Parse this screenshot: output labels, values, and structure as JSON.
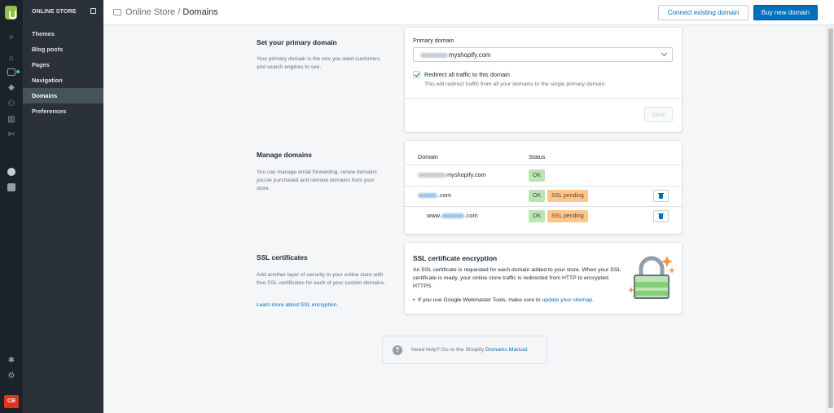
{
  "sidebar": {
    "section_title": "ONLINE STORE",
    "items": [
      {
        "label": "Themes"
      },
      {
        "label": "Blog posts"
      },
      {
        "label": "Pages"
      },
      {
        "label": "Navigation"
      },
      {
        "label": "Domains",
        "active": true
      },
      {
        "label": "Preferences"
      }
    ],
    "rail_icons": [
      "shopify-logo-icon",
      "search-icon",
      "home-icon",
      "orders-icon",
      "tag-icon",
      "customers-icon",
      "analytics-icon",
      "discounts-icon",
      "online-store-icon",
      "facebook-icon",
      "apps-icon",
      "settings-icon"
    ],
    "avatar_initials": "CB"
  },
  "header": {
    "breadcrumb_parent": "Online Store",
    "breadcrumb_sep": "/",
    "breadcrumb_current": "Domains",
    "connect_button": "Connect existing domain",
    "buy_button": "Buy new domain"
  },
  "primary": {
    "title": "Set your primary domain",
    "description": "Your primary domain is the one you want customers and search engines to see.",
    "field_label": "Primary domain",
    "selected_domain_suffix": "myshopify.com",
    "redirect_label": "Redirect all traffic to this domain",
    "redirect_checked": true,
    "redirect_help": "This will redirect traffic from all your domains to the single primary domain.",
    "save_label": "Save"
  },
  "manage": {
    "title": "Manage domains",
    "description": "You can manage email forwarding, renew domains you've purchased and remove domains from your store.",
    "columns": [
      "Domain",
      "Status"
    ],
    "rows": [
      {
        "prefix": "",
        "suffix": "myshopify.com",
        "status": "OK",
        "ssl": null,
        "link": false,
        "deletable": false
      },
      {
        "prefix": "",
        "suffix": ".com",
        "status": "OK",
        "ssl": "SSL pending",
        "link": true,
        "deletable": true
      },
      {
        "prefix": "www.",
        "suffix": ".com",
        "status": "OK",
        "ssl": "SSL pending",
        "link": true,
        "deletable": true
      }
    ]
  },
  "ssl": {
    "title": "SSL certificates",
    "description": "Add another layer of security to your online store with free SSL certificates for each of your custom domains.",
    "learn_link": "Learn more about SSL encryption.",
    "card_title": "SSL certificate encryption",
    "card_body": "An SSL certificate is requested for each domain added to your store. When your SSL certificate is ready, your online store traffic is redirected from HTTP to encrypted HTTPS.",
    "bullet_text": "If you use Google Webmaster Tools, make sure to ",
    "bullet_link": "update your sitemap",
    "bullet_end": "."
  },
  "help": {
    "text": "Need help? Go to the Shopify ",
    "link": "Domains Manual",
    "end": "."
  },
  "colors": {
    "primary": "#006fbb",
    "ok_badge": "#bbe5b3",
    "ssl_badge": "#ffc58b",
    "brand": "#95bf47"
  }
}
